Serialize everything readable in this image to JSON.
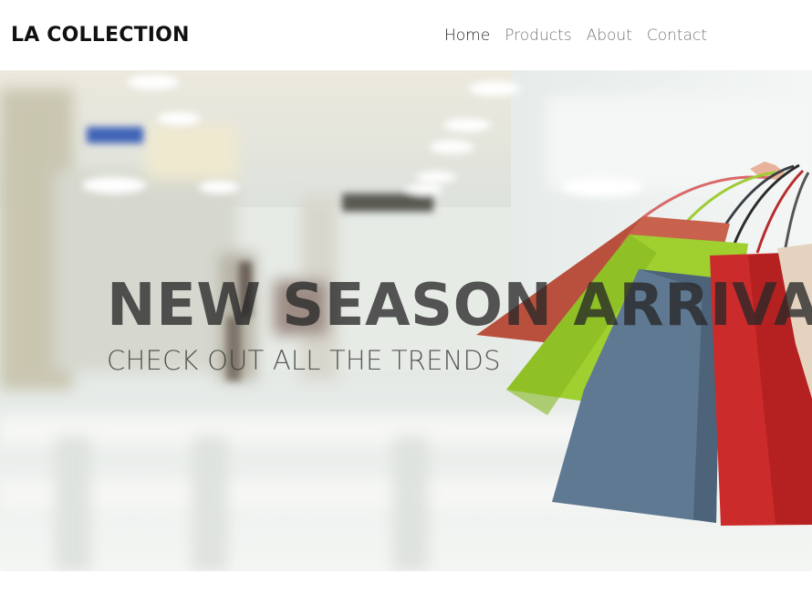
{
  "header": {
    "brand": "LA COLLECTION",
    "nav": [
      {
        "label": "Home",
        "active": true
      },
      {
        "label": "Products",
        "active": false
      },
      {
        "label": "About",
        "active": false
      },
      {
        "label": "Contact",
        "active": false
      }
    ]
  },
  "hero": {
    "heading": "NEW SEASON ARRIVALS",
    "subheading": "CHECK OUT ALL THE TRENDS",
    "image": "shopping-bags-mall-photo"
  },
  "colors": {
    "brand_text": "#111111",
    "nav_active": "#222222",
    "nav_inactive": "#777777",
    "bag_red": "#cc2a2a",
    "bag_green": "#9ccc2e",
    "bag_blue": "#5f7a95",
    "bag_brown": "#b85a45"
  }
}
